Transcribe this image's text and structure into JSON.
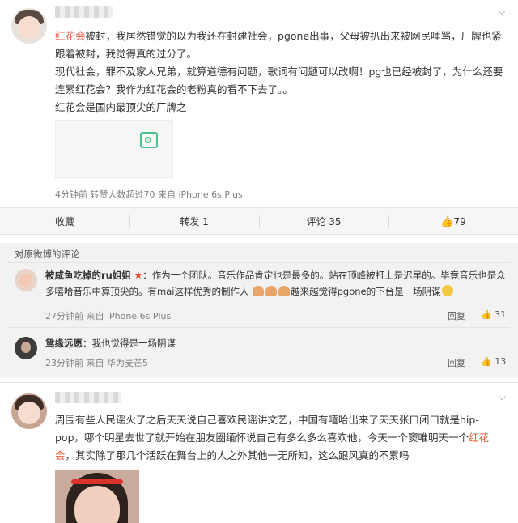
{
  "post1": {
    "text_red": "红花会",
    "text_p1_rest": "被封，我居然错觉的以为我还在封建社会，pgone出事，父母被扒出来被网民唾骂，厂牌也紧跟着被封，我觉得真的过分了。",
    "text_p2": "现代社会，罪不及家人兄弟，就算道德有问题，歌词有问题可以改啊！pg也已经被封了，为什么还要连累红花会？我作为红花会的老粉真的看不下去了。。",
    "text_p3": "红花会是国内最顶尖的厂牌之",
    "meta": "4分钟前 转赞人数超过70 来自 iPhone 6s Plus"
  },
  "actions": {
    "collect": "收藏",
    "repost": "转发 1",
    "comment": "评论 35",
    "like": "79"
  },
  "comments": {
    "title": "对原微博的评论",
    "items": [
      {
        "user": "被咸鱼吃掉的ru姐姐",
        "text_a": "：作为一个团队。音乐作品肯定也是最多的。站在顶峰被打上是迟早的。毕竟音乐也是众多嘻哈音乐中算顶尖的。有mai这样优秀的制作人",
        "text_b": "越来越觉得pgone的下台是一场阴谋",
        "meta": "27分钟前 来自 iPhone 6s Plus",
        "reply": "回复",
        "likes": "31"
      },
      {
        "user": "鸳缘远愿",
        "text_a": "：我也觉得是一场阴谋",
        "meta": "23分钟前 来自 华为麦芒5",
        "reply": "回复",
        "likes": "13"
      }
    ]
  },
  "post2": {
    "text_a": "周围有些人民谣火了之后天天说自己喜欢民谣讲文艺，中国有嘻哈出来了天天张口闭口就是hip-pop，哪个明星去世了就开始在朋友圈缅怀说自己有多么多么喜欢他，今天一个窦唯明天一个",
    "text_red1": "红花",
    "text_red2": "会",
    "text_b": "，其实除了那几个活跃在舞台上的人之外其他一无所知，这么跟风真的不累吗"
  }
}
